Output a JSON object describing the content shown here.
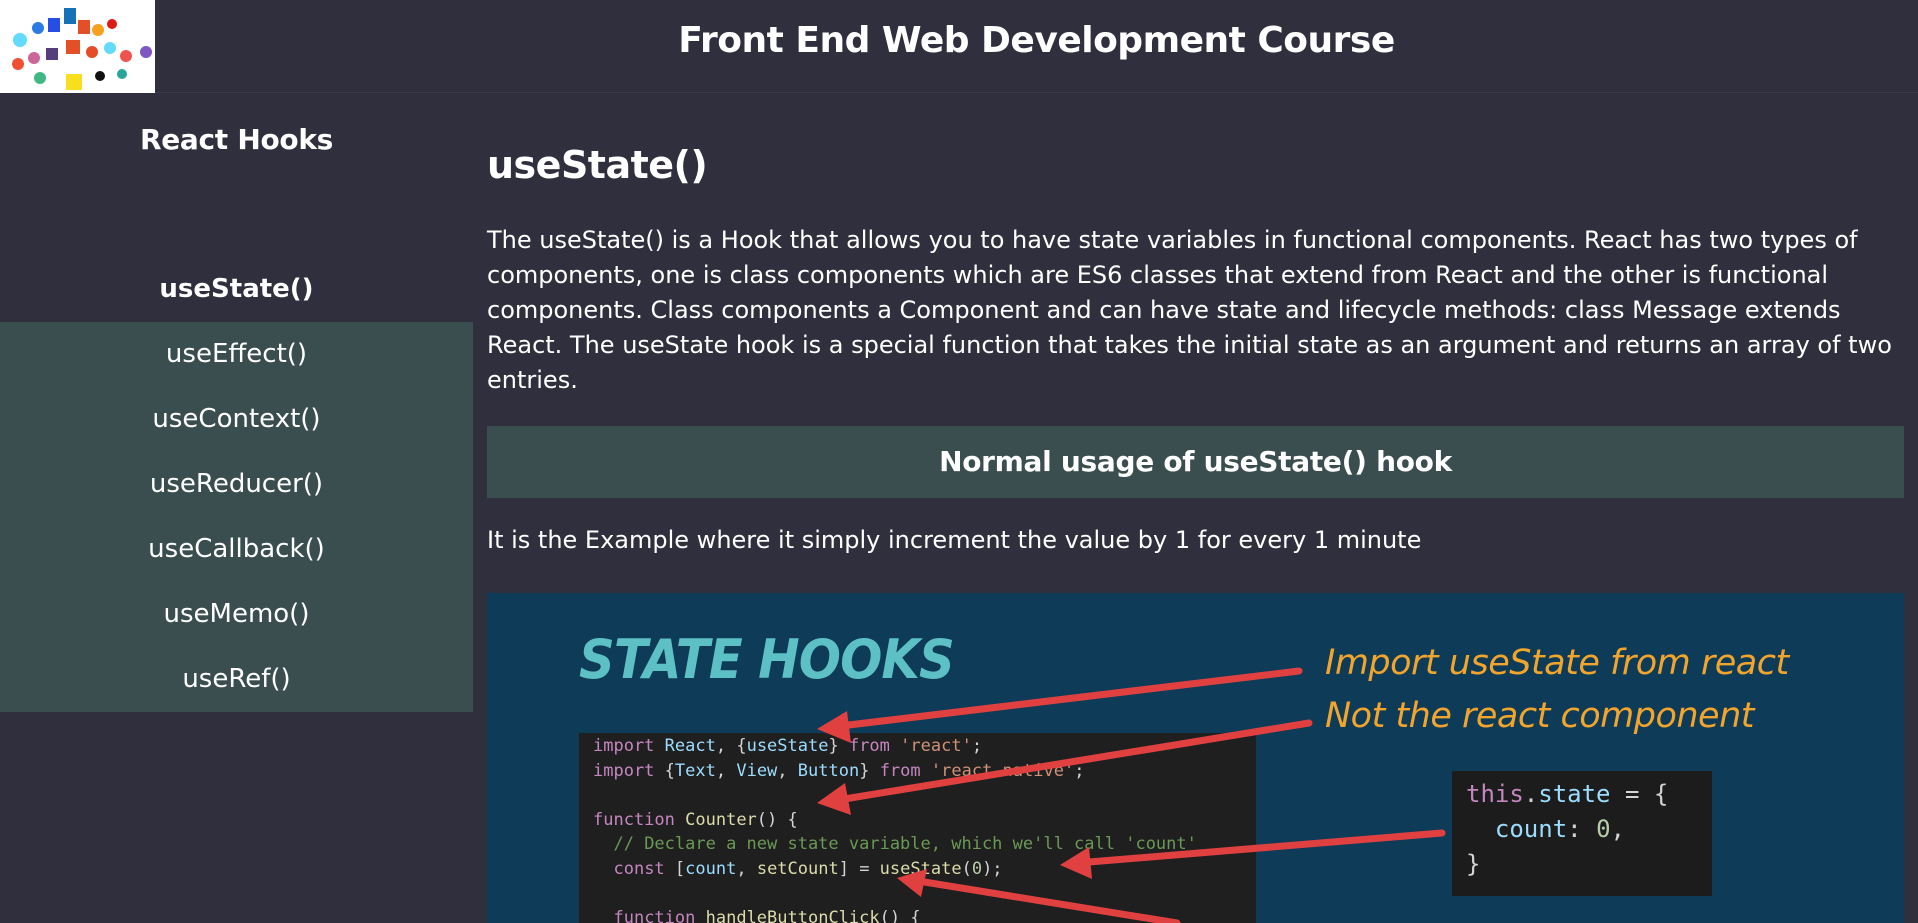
{
  "header": {
    "title": "Front End Web Development Course",
    "logo_name": "tech-logos-collage"
  },
  "sidebar": {
    "heading": "React Hooks",
    "items": [
      {
        "label": "useState()",
        "active": true
      },
      {
        "label": "useEffect()",
        "active": false
      },
      {
        "label": "useContext()",
        "active": false
      },
      {
        "label": "useReducer()",
        "active": false
      },
      {
        "label": "useCallback()",
        "active": false
      },
      {
        "label": "useMemo()",
        "active": false
      },
      {
        "label": "useRef()",
        "active": false
      }
    ]
  },
  "main": {
    "title": "useState()",
    "description": "The useState() is a Hook that allows you to have state variables in functional components. React has two types of components, one is class components which are ES6 classes that extend from React and the other is functional components. Class components a Component and can have state and lifecycle methods: class Message extends React. The useState hook is a special function that takes the initial state as an argument and returns an array of two entries.",
    "subheading": "Normal usage of useState() hook",
    "caption": "It is the Example where it simply increment the value by 1 for every 1 minute",
    "figure": {
      "title": "STATE HOOKS",
      "note1": "Import useState from react",
      "note2": "Not the react component"
    }
  },
  "colors": {
    "background": "#302f3d",
    "accent_panel": "#3b4e4f",
    "figure_bg": "#0e3b57",
    "figure_title": "#5cc0c5",
    "note": "#f2a52c",
    "arrow": "#e04040"
  }
}
